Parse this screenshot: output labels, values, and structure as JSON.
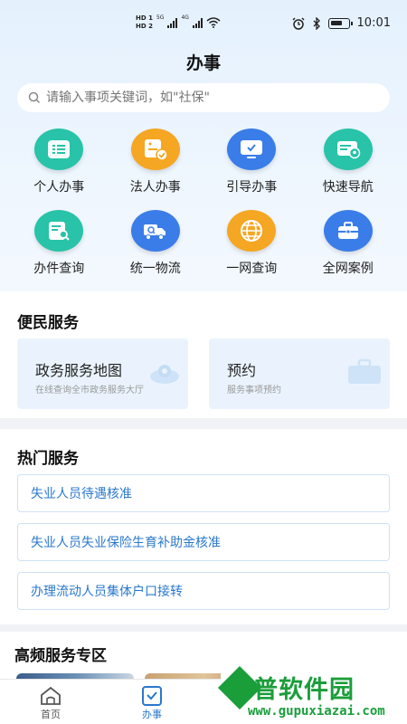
{
  "status_bar": {
    "hd1": "HD 1",
    "hd2": "HD 2",
    "net1": "5G",
    "net2": "4G",
    "time": "10:01"
  },
  "header": {
    "title": "办事"
  },
  "search": {
    "placeholder": "请输入事项关键词，如\"社保\""
  },
  "services": [
    {
      "label": "个人办事",
      "icon": "list-icon",
      "color": "#28c3a8"
    },
    {
      "label": "法人办事",
      "icon": "badge-check-icon",
      "color": "#f5a623"
    },
    {
      "label": "引导办事",
      "icon": "monitor-check-icon",
      "color": "#3a7de8"
    },
    {
      "label": "快速导航",
      "icon": "map-pin-card-icon",
      "color": "#28c3a8"
    },
    {
      "label": "办件查询",
      "icon": "document-search-icon",
      "color": "#28c3a8"
    },
    {
      "label": "统一物流",
      "icon": "truck-search-icon",
      "color": "#3a7de8"
    },
    {
      "label": "一网查询",
      "icon": "globe-icon",
      "color": "#f5a623"
    },
    {
      "label": "全网案例",
      "icon": "briefcase-icon",
      "color": "#3a7de8"
    }
  ],
  "convenience": {
    "title": "便民服务",
    "cards": [
      {
        "title": "政务服务地图",
        "subtitle": "在线查询全市政务服务大厅"
      },
      {
        "title": "预约",
        "subtitle": "服务事项预约"
      }
    ]
  },
  "hot": {
    "title": "热门服务",
    "items": [
      "失业人员待遇核准",
      "失业人员失业保险生育补助金核准",
      "办理流动人员集体户口接转"
    ]
  },
  "high_freq": {
    "title": "高频服务专区"
  },
  "tabbar": {
    "tabs": [
      {
        "label": "首页",
        "icon": "home-icon",
        "active": false
      },
      {
        "label": "办事",
        "icon": "checkbox-icon",
        "active": true
      }
    ]
  },
  "watermark": {
    "title": "谷普软件园",
    "url": "www.gupuxiazai.com"
  }
}
